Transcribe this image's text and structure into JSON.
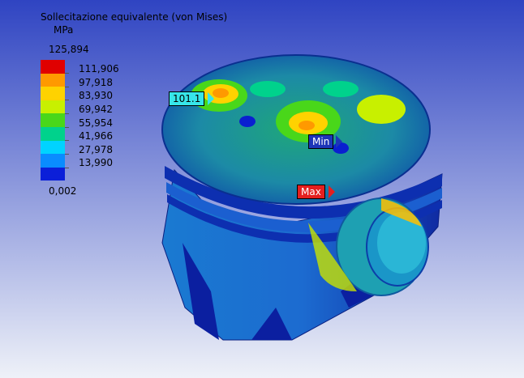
{
  "legend": {
    "title": "Sollecitazione equivalente (von Mises)",
    "unit": "MPa",
    "max_value": "125,894",
    "min_value": "0,002",
    "levels": [
      "111,906",
      "97,918",
      "83,930",
      "69,942",
      "55,954",
      "41,966",
      "27,978",
      "13,990"
    ],
    "colors": [
      "#e00000",
      "#ff9900",
      "#ffd200",
      "#c8f000",
      "#49d71a",
      "#00d28c",
      "#00d3ff",
      "#0a8cff",
      "#0b1fd9"
    ]
  },
  "probes": {
    "value_label": "101.1",
    "min_label": "Min",
    "max_label": "Max"
  },
  "colors": {
    "background_top": "#2f44c2",
    "background_bottom": "#eef1f8"
  }
}
